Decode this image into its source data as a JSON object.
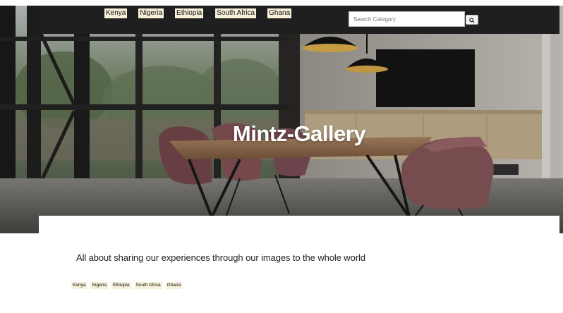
{
  "hero": {
    "title": "Mintz-Gallery"
  },
  "nav": {
    "links": [
      "Kenya",
      "Nigeria",
      "Ethiopia",
      "South Africa",
      "Ghana"
    ]
  },
  "search": {
    "placeholder": "Search Category",
    "button_icon": "search-icon"
  },
  "tagline": "All about sharing our experiences through our images to the whole world",
  "footer": {
    "links": [
      "Kenya",
      "Nigeria",
      "Ethiopia",
      "South Africa",
      "Ghana"
    ]
  },
  "colors": {
    "navbar_bg": "#1f1f1f",
    "link_bg": "#f6efd9",
    "hero_text": "#ffffff",
    "tagline_text": "#222222"
  }
}
